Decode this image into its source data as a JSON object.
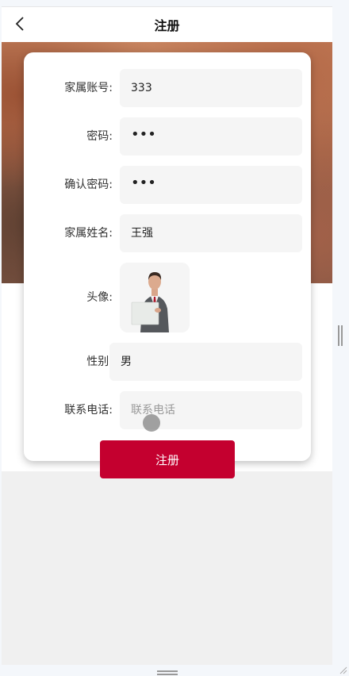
{
  "header": {
    "title": "注册",
    "back_icon": "chevron-left-icon"
  },
  "form": {
    "account": {
      "label": "家属账号:",
      "value": "333"
    },
    "password": {
      "label": "密码:",
      "value": "•••"
    },
    "confirm_password": {
      "label": "确认密码:",
      "value": "•••"
    },
    "name": {
      "label": "家属姓名:",
      "value": "王强"
    },
    "avatar": {
      "label": "头像:"
    },
    "gender": {
      "label": "性别:",
      "value": "男"
    },
    "phone": {
      "label": "联系电话:",
      "placeholder": "联系电话"
    }
  },
  "submit_label": "注册",
  "colors": {
    "primary": "#c4002f",
    "field_bg": "#f5f5f5",
    "page_bg": "#f0f0f0"
  }
}
